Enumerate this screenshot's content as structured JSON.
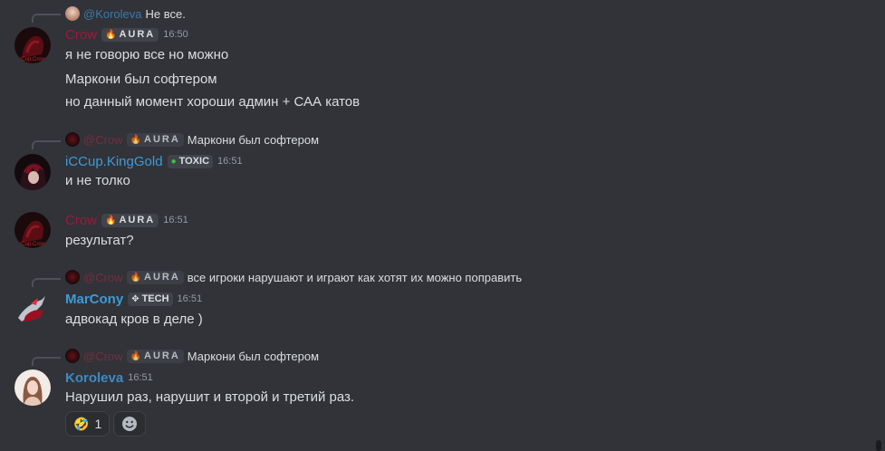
{
  "messages": {
    "m1": {
      "reply_mention": "@Koroleva",
      "reply_text": "Не все.",
      "author": "Crow",
      "tag": "AURA",
      "time": "16:50",
      "lines": [
        "я не говорю все но можно",
        "Маркони был софтером",
        "но данный момент хороши админ + САА катов"
      ]
    },
    "m2": {
      "reply_mention": "@Crow",
      "reply_tag": "AURA",
      "reply_text": "Маркони был софтером",
      "author": "iCCup.KingGold",
      "tag": "TOXIC",
      "time": "16:51",
      "lines": [
        "и не толко"
      ]
    },
    "m3": {
      "author": "Crow",
      "tag": "AURA",
      "time": "16:51",
      "lines": [
        "результат?"
      ]
    },
    "m4": {
      "reply_mention": "@Crow",
      "reply_tag": "AURA",
      "reply_text": "все игроки нарушают и играют как хотят их можно поправить",
      "author": "MarCony",
      "tag": "TECH",
      "time": "16:51",
      "lines": [
        "адвокад кров в деле )"
      ]
    },
    "m5": {
      "reply_mention": "@Crow",
      "reply_tag": "AURA",
      "reply_text": "Маркони был софтером",
      "author": "Koroleva",
      "time": "16:51",
      "lines": [
        "Нарушил раз, нарушит и второй и третий раз."
      ],
      "reactions": [
        {
          "emoji": "🤣",
          "count": "1"
        }
      ]
    }
  },
  "colors": {
    "background": "#313338",
    "crow": "#a0173b",
    "blue_name": "#3e9ad8",
    "tag_bg": "#41434a"
  }
}
